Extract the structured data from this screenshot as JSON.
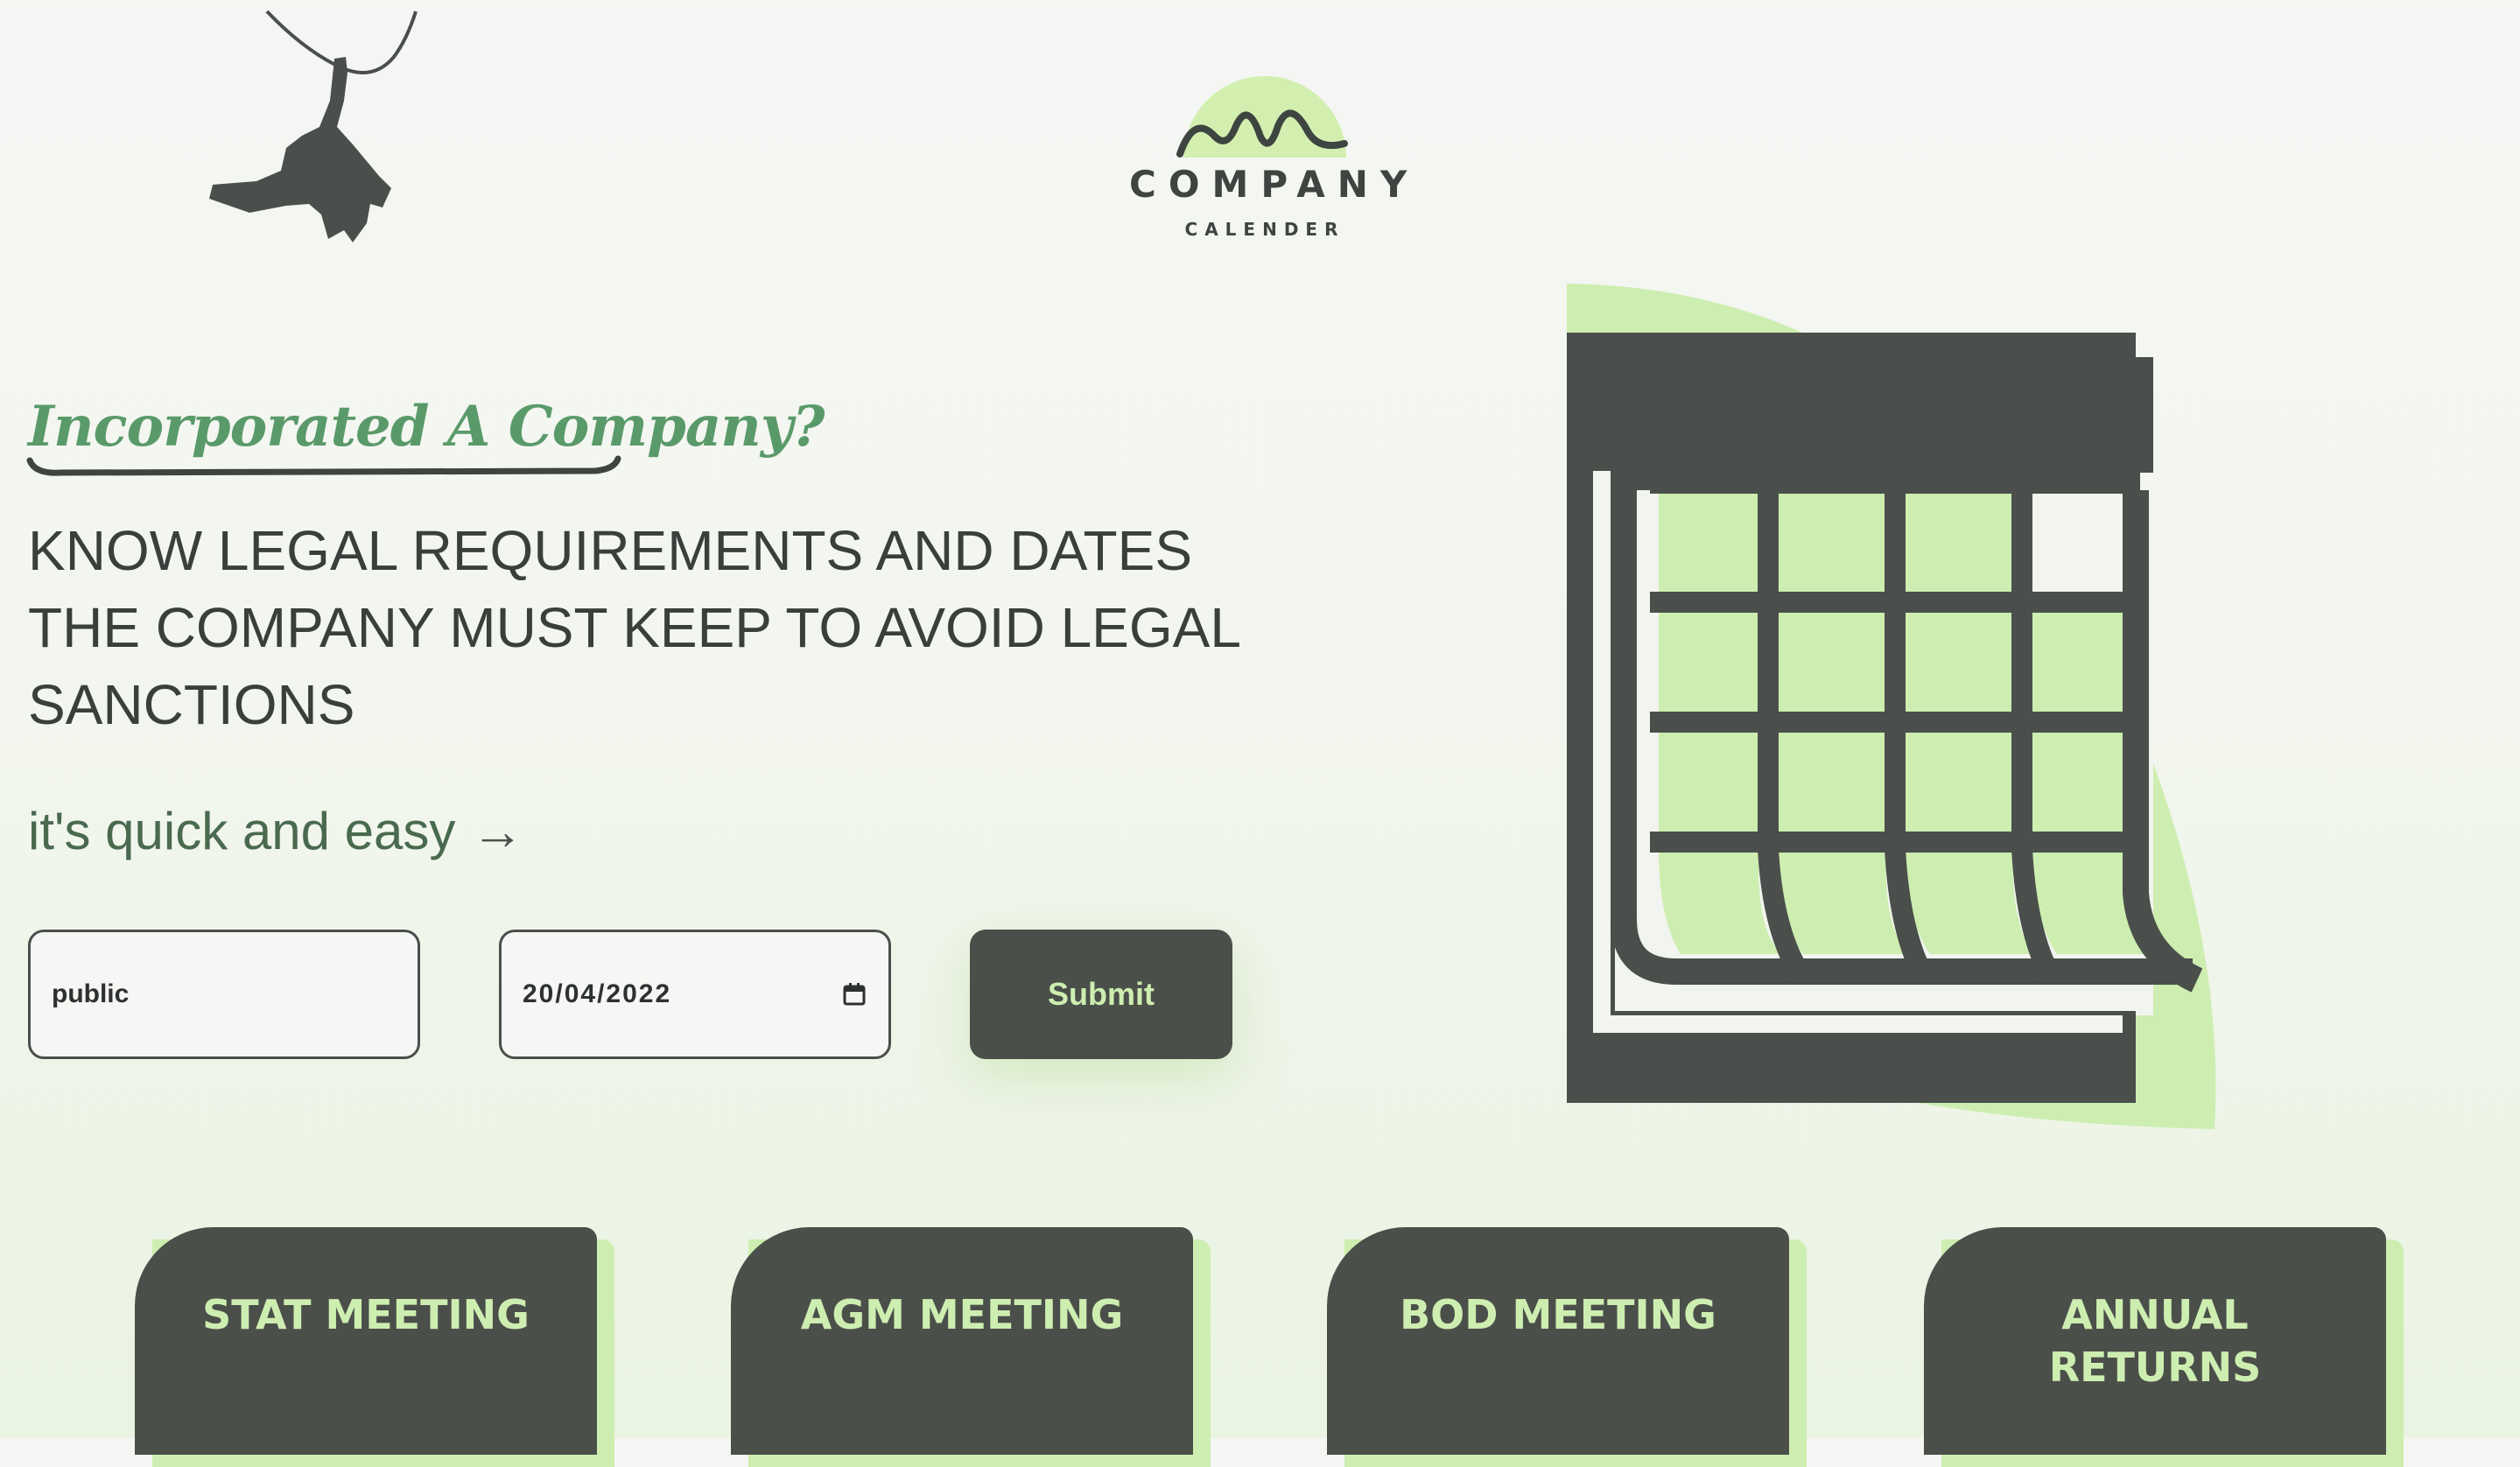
{
  "header": {
    "logo_word": "COMPANY",
    "logo_sub": "CALENDER"
  },
  "hero": {
    "tagline": "Incorporated A Company?",
    "headline": "KNOW LEGAL REQUIREMENTS AND DATES THE COMPANY MUST KEEP TO AVOID LEGAL SANCTIONS",
    "quick": "it's quick and easy",
    "arrow": "→"
  },
  "form": {
    "company_type_value": "public",
    "date_value": "20/04/2022",
    "submit_label": "Submit"
  },
  "cards": [
    {
      "label": "STAT MEETING"
    },
    {
      "label": "AGM MEETING"
    },
    {
      "label": "BOD MEETING"
    },
    {
      "label": "ANNUAL RETURNS"
    }
  ],
  "colors": {
    "dark": "#4b4f4a",
    "accent": "#cdeeb0",
    "green_text": "#5a9a6a"
  }
}
